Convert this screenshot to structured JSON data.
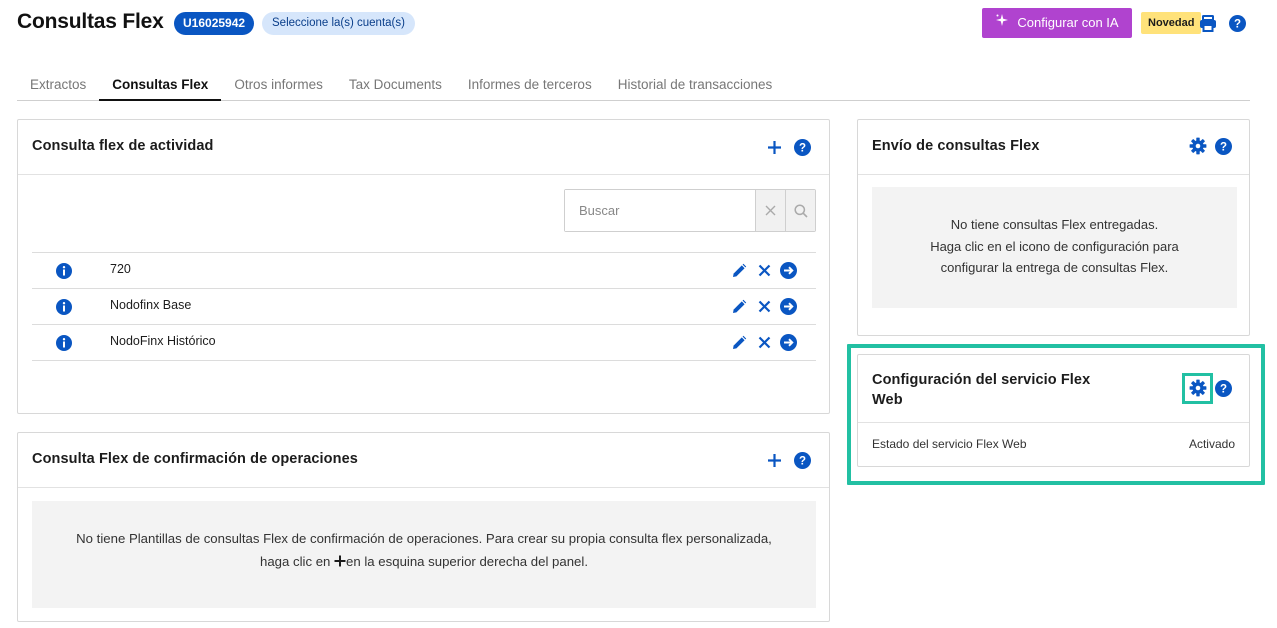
{
  "header": {
    "title": "Consultas Flex",
    "account_id": "U16025942",
    "account_select": "Seleccione la(s) cuenta(s)",
    "ai_button": "Configurar con IA",
    "new_badge": "Novedad",
    "icons": {
      "ai": "sparkle-icon",
      "print": "printer-icon",
      "help": "help-icon"
    }
  },
  "tabs": [
    "Extractos",
    "Consultas Flex",
    "Otros informes",
    "Tax Documents",
    "Informes de terceros",
    "Historial de transacciones"
  ],
  "active_tab": "Consultas Flex",
  "activity_panel": {
    "title": "Consulta flex de actividad",
    "search_placeholder": "Buscar",
    "rows": [
      {
        "name": "720"
      },
      {
        "name": "Nodofinx Base"
      },
      {
        "name": "NodoFinx Histórico"
      }
    ],
    "row_icons": [
      "info-icon",
      "edit-icon",
      "delete-icon",
      "run-icon"
    ]
  },
  "confirm_panel": {
    "title": "Consulta Flex de confirmación de operaciones",
    "empty_line1": "No tiene Plantillas de consultas Flex de confirmación de operaciones. Para crear su propia consulta flex personalizada,",
    "empty_line2_pre": "haga clic en ",
    "empty_line2_post": "en la esquina superior derecha del panel."
  },
  "delivery_panel": {
    "title": "Envío de consultas Flex",
    "empty_line1": "No tiene consultas Flex entregadas.",
    "empty_line2": "Haga clic en el icono de configuración para",
    "empty_line3": "configurar la entrega de consultas Flex."
  },
  "service_panel": {
    "title_line1": "Configuración del servicio Flex",
    "title_line2": "Web",
    "status_label": "Estado del servicio Flex Web",
    "status_value": "Activado"
  },
  "colors": {
    "brand_blue": "#0a56c2",
    "ai_purple": "#b043cf",
    "badge_yellow": "#ffe27a",
    "highlight": "#22c0a3"
  }
}
